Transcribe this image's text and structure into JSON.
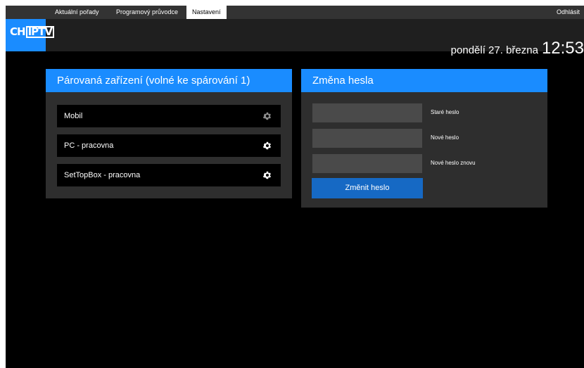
{
  "nav": {
    "items": [
      {
        "label": "Aktuální pořady",
        "active": false
      },
      {
        "label": "Programový průvodce",
        "active": false
      },
      {
        "label": "Nastavení",
        "active": true
      }
    ],
    "logout": "Odhlásit"
  },
  "logo": {
    "left": "CH",
    "boxed": "IPTV"
  },
  "header": {
    "date": "pondělí 27. března",
    "time": "12:53"
  },
  "devices": {
    "title": "Párovaná zařízení (volné ke spárování 1)",
    "items": [
      {
        "label": "Mobil",
        "icon": "gear-icon",
        "icon_color": "#8c8c8c"
      },
      {
        "label": "PC - pracovna",
        "icon": "gear-icon",
        "icon_color": "#ffffff"
      },
      {
        "label": "SetTopBox - pracovna",
        "icon": "gear-icon",
        "icon_color": "#ffffff"
      }
    ]
  },
  "password": {
    "title": "Změna hesla",
    "fields": [
      {
        "label": "Staré heslo",
        "value": ""
      },
      {
        "label": "Nové heslo",
        "value": ""
      },
      {
        "label": "Nové heslo znovu",
        "value": ""
      }
    ],
    "button": "Změnit heslo"
  },
  "colors": {
    "accent": "#1a8cff",
    "button": "#1669c4",
    "background": "#000000",
    "panel": "#2e2e2e",
    "header": "#1f1f1f",
    "nav": "#333333"
  }
}
